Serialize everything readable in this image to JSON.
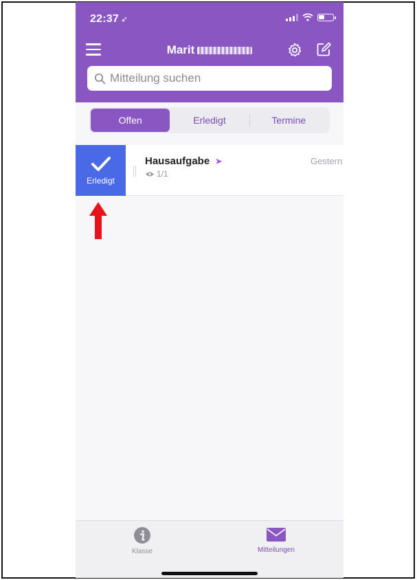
{
  "status": {
    "time": "22:37"
  },
  "header": {
    "title": "Marit",
    "search_placeholder": "Mitteilung suchen"
  },
  "segments": [
    {
      "label": "Offen",
      "active": true
    },
    {
      "label": "Erledigt",
      "active": false
    },
    {
      "label": "Termine",
      "active": false
    }
  ],
  "message": {
    "title": "Hausaufgabe",
    "views": "1/1",
    "date": "Gestern",
    "swipe_action_label": "Erledigt"
  },
  "tabbar": {
    "items": [
      {
        "label": "Klasse",
        "icon": "info-icon",
        "active": false
      },
      {
        "label": "Mitteilungen",
        "icon": "envelope-icon",
        "active": true
      }
    ]
  },
  "colors": {
    "brand": "#8a57c2",
    "swipe_action": "#4a69e6",
    "annotation_arrow": "#e8141b"
  }
}
